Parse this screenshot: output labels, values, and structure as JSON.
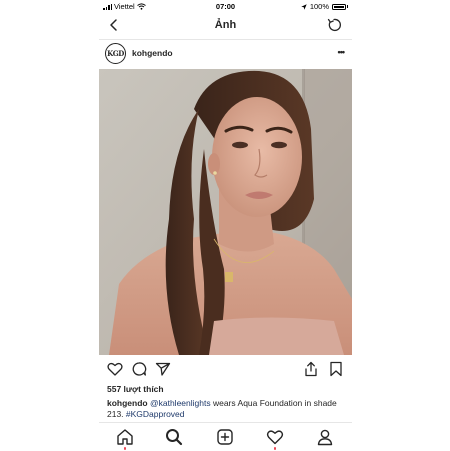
{
  "status_bar": {
    "carrier": "Viettel",
    "time": "07:00",
    "battery": "100%"
  },
  "nav": {
    "title": "Ảnh"
  },
  "post": {
    "username": "kohgendo",
    "avatar_text": "KGD",
    "likes": "557 lượt thích",
    "caption": {
      "username": "kohgendo",
      "mention": "@kathleenlights",
      "text": " wears Aqua Foundation in shade 213. ",
      "hashtag": "#KGDapproved"
    }
  },
  "icons": {
    "back": "chevron-left-icon",
    "refresh": "refresh-icon",
    "more": "more-icon",
    "like": "heart-icon",
    "comment": "comment-icon",
    "share": "send-icon",
    "upload": "share-icon",
    "save": "bookmark-icon",
    "home": "home-icon",
    "search": "search-icon",
    "add": "add-icon",
    "activity": "heart-icon",
    "profile": "profile-icon"
  },
  "colors": {
    "notification_dot": "#ed4956",
    "link": "#1f3a6b"
  }
}
